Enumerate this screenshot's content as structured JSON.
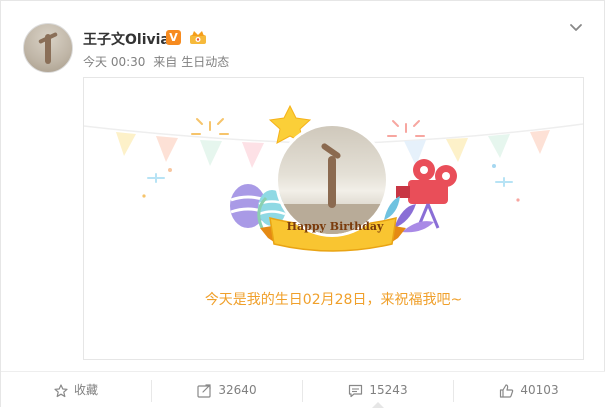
{
  "post": {
    "username": "王子文Olivia",
    "verified_badge": "V",
    "time": "今天 00:30",
    "source_prefix": "来自",
    "source": "生日动态"
  },
  "card": {
    "banner_text": "Happy Birthday",
    "message": "今天是我的生日02月28日，来祝福我吧~"
  },
  "actions": {
    "favorite_label": "收藏",
    "repost_count": "32640",
    "comment_count": "15243",
    "like_count": "40103"
  },
  "colors": {
    "accent_orange": "#f0a02b",
    "vip_orange": "#f78b1f",
    "text_gray": "#808080"
  },
  "icons": [
    "chevron-down-icon",
    "vip-crown-icon",
    "star-icon",
    "repost-icon",
    "comment-icon",
    "like-icon"
  ]
}
